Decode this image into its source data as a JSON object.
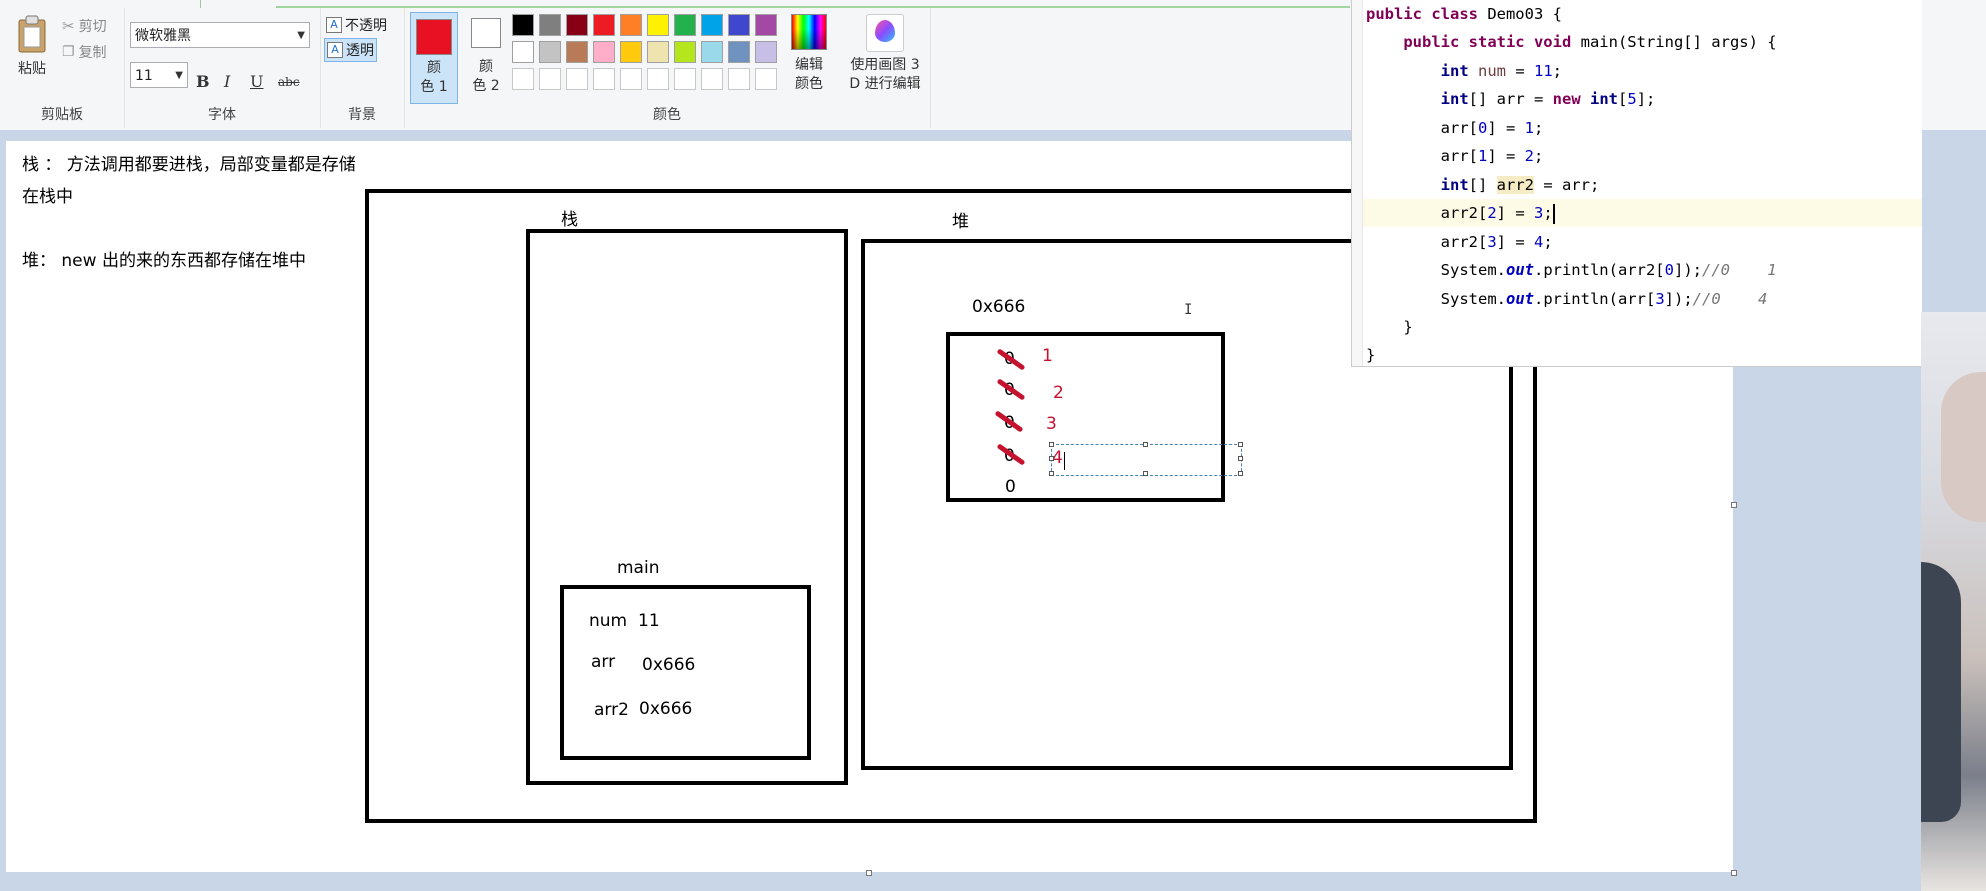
{
  "ribbon": {
    "clipboard": {
      "paste_label": "粘贴",
      "cut_label": "剪切",
      "copy_label": "复制",
      "group_label": "剪贴板"
    },
    "font": {
      "family": "微软雅黑",
      "size": "11",
      "bold": "B",
      "italic": "I",
      "underline": "U",
      "strike": "abc",
      "group_label": "字体"
    },
    "background": {
      "opaque_label": "不透明",
      "transparent_label": "透明",
      "group_label": "背景"
    },
    "colors": {
      "color1_label_line1": "颜",
      "color1_label_line2": "色 1",
      "color2_label_line1": "颜",
      "color2_label_line2": "色 2",
      "color1_value": "#e81123",
      "color2_value": "#ffffff",
      "edit_colors_line1": "编辑",
      "edit_colors_line2": "颜色",
      "paint3d_line1": "使用画图 3",
      "paint3d_line2": "D 进行编辑",
      "group_label": "颜色",
      "palette_row1": [
        "#000000",
        "#7f7f7f",
        "#880015",
        "#ed1c24",
        "#ff7f27",
        "#fff200",
        "#22b14c",
        "#00a2e8",
        "#3f48cc",
        "#a349a4"
      ],
      "palette_row2": [
        "#ffffff",
        "#c3c3c3",
        "#b97a57",
        "#ffaec9",
        "#ffc90e",
        "#efe4b0",
        "#b5e61d",
        "#99d9ea",
        "#7092be",
        "#c8bfe7"
      ],
      "palette_row3": [
        "#ffffff",
        "#ffffff",
        "#ffffff",
        "#ffffff",
        "#ffffff",
        "#ffffff",
        "#ffffff",
        "#ffffff",
        "#ffffff",
        "#ffffff"
      ]
    }
  },
  "canvas": {
    "note_line1": "栈 ：  方法调用都要进栈，局部变量都是存储",
    "note_line2": "在栈中",
    "note_line3": "堆：  new 出的来的东西都存储在堆中",
    "stack_label": "栈",
    "heap_label": "堆",
    "main_label": "main",
    "main_rows": [
      {
        "name": "num",
        "value": "11"
      },
      {
        "name": "arr",
        "value": "0x666"
      },
      {
        "name": "arr2",
        "value": "0x666"
      }
    ],
    "array_address": "0x666",
    "array_old_values": [
      "0",
      "0",
      "0",
      "0",
      "0"
    ],
    "array_new_values": [
      "1",
      "2",
      "3",
      "4"
    ]
  },
  "editor": {
    "lines": [
      "public class Demo03 {",
      "    public static void main(String[] args) {",
      "        int num = 11;",
      "        int[] arr = new int[5];",
      "        arr[0] = 1;",
      "        arr[1] = 2;",
      "        int[] arr2 = arr;",
      "        arr2[2] = 3;",
      "        arr2[3] = 4;",
      "        System.out.println(arr2[0]);//0    1",
      "        System.out.println(arr[3]);//0    4",
      "    }",
      "}"
    ]
  }
}
